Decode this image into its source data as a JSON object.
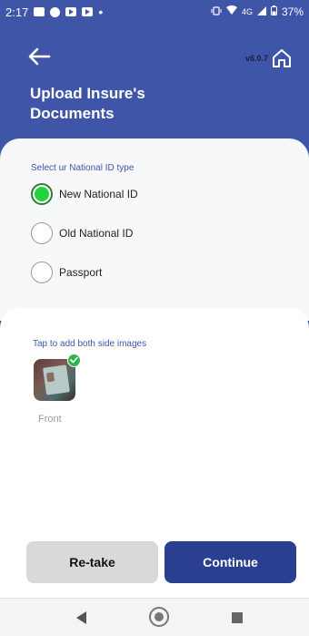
{
  "status_bar": {
    "time": "2:17",
    "dot": "•",
    "network": "4G",
    "battery": "37%"
  },
  "header": {
    "version": "v6.0.7",
    "title": "Upload Insure's Documents",
    "back_icon": "arrow-left-icon",
    "home_icon": "home-icon"
  },
  "id_type": {
    "label": "Select ur National ID type",
    "options": [
      {
        "label": "New National ID",
        "selected": true
      },
      {
        "label": "Old National ID",
        "selected": false
      },
      {
        "label": "Passport",
        "selected": false
      }
    ]
  },
  "upload": {
    "hint": "Tap to add both side images",
    "thumbnail_label": "Front"
  },
  "actions": {
    "retake_label": "Re-take",
    "continue_label": "Continue"
  },
  "colors": {
    "primary": "#3f56a8",
    "continue_button": "#2a3f8f",
    "selected_radio": "#22d33a"
  }
}
